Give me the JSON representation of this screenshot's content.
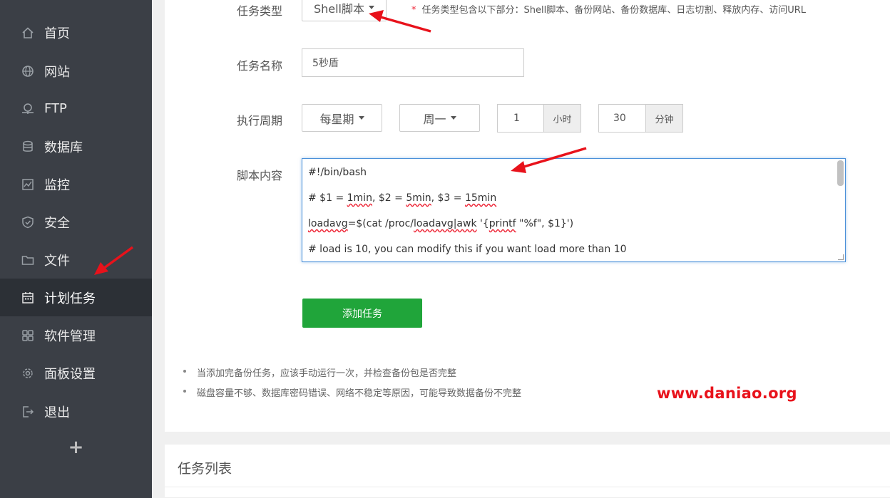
{
  "sidebar": {
    "items": [
      {
        "label": "首页",
        "icon": "home-icon"
      },
      {
        "label": "网站",
        "icon": "globe-icon"
      },
      {
        "label": "FTP",
        "icon": "ftp-icon"
      },
      {
        "label": "数据库",
        "icon": "database-icon"
      },
      {
        "label": "监控",
        "icon": "monitor-icon"
      },
      {
        "label": "安全",
        "icon": "shield-icon"
      },
      {
        "label": "文件",
        "icon": "folder-icon"
      },
      {
        "label": "计划任务",
        "icon": "calendar-icon",
        "active": true
      },
      {
        "label": "软件管理",
        "icon": "apps-icon"
      },
      {
        "label": "面板设置",
        "icon": "gear-icon"
      },
      {
        "label": "退出",
        "icon": "logout-icon"
      }
    ],
    "add_label": "+"
  },
  "form": {
    "task_type_label": "任务类型",
    "task_type_value": "Shell脚本",
    "task_type_hint_star": "*",
    "task_type_hint": "任务类型包含以下部分：Shell脚本、备份网站、备份数据库、日志切割、释放内存、访问URL",
    "task_name_label": "任务名称",
    "task_name_value": "5秒盾",
    "cycle_label": "执行周期",
    "cycle_period": "每星期",
    "cycle_weekday": "周一",
    "cycle_hour": "1",
    "cycle_hour_unit": "小时",
    "cycle_minute": "30",
    "cycle_minute_unit": "分钟",
    "script_label": "脚本内容",
    "script_lines": [
      "#!/bin/bash",
      "# $1 = 1min, $2 = 5min, $3 = 15min",
      "loadavg=$(cat /proc/loadavg|awk '{printf \"%f\", $1}')",
      "# load is 10, you can modify this if you want load more than 10"
    ],
    "add_button": "添加任务"
  },
  "tips": [
    "当添加完备份任务，应该手动运行一次，并检查备份包是否完整",
    "磁盘容量不够、数据库密码错误、网络不稳定等原因，可能导致数据备份不完整"
  ],
  "watermark": "www.daniao.org",
  "task_list_title": "任务列表",
  "colors": {
    "sidebar_bg": "#3b3f46",
    "sidebar_active": "#2c3036",
    "accent_green": "#20a53a",
    "annotation_red": "#e8121b"
  }
}
